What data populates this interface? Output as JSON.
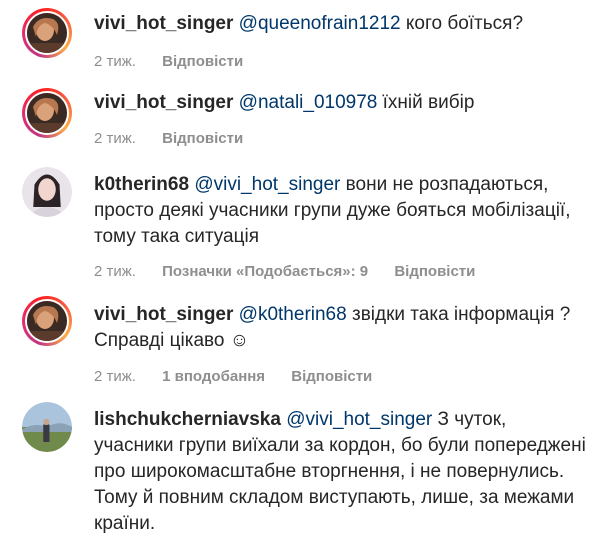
{
  "comments": [
    {
      "username": "vivi_hot_singer",
      "mention": "@queenofrain1212",
      "text": " кого боїться?",
      "time": "2 тиж.",
      "likes": "",
      "reply": "Відповісти",
      "avatar": "profile-photo"
    },
    {
      "username": "vivi_hot_singer",
      "mention": "@natali_010978",
      "text": " їхній вибір",
      "time": "2 тиж.",
      "likes": "",
      "reply": "Відповісти",
      "avatar": "profile-photo"
    },
    {
      "username": "k0therin68",
      "mention": "@vivi_hot_singer",
      "text": " вони не розпадаються, просто деякі учасники групи дуже бояться мобілізації, тому така ситуація",
      "time": "2 тиж.",
      "likes": "Позначки «Подобається»: 9",
      "reply": "Відповісти",
      "avatar": "profile-photo"
    },
    {
      "username": "vivi_hot_singer",
      "mention": "@k0therin68",
      "text": " звідки така інформація ? Справді цікаво ☺",
      "time": "2 тиж.",
      "likes": "1 вподобання",
      "reply": "Відповісти",
      "avatar": "profile-photo"
    },
    {
      "username": "lishchukcherniavska",
      "mention": "@vivi_hot_singer",
      "text": " З чуток, учасники групи виїхали за кордон, бо були попереджені про широкомасштабне вторгнення, і не повернулись. Тому й повним складом виступають, лише, за межами країни.",
      "time": "",
      "likes": "",
      "reply": "",
      "avatar": "profile-photo"
    }
  ],
  "colors": {
    "text": "#262626",
    "mention": "#00376b",
    "meta": "#8e8e8e",
    "story_ring": "#e1306c"
  }
}
